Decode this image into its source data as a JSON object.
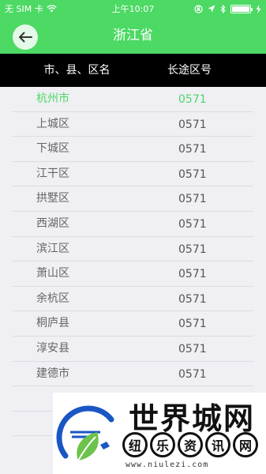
{
  "status_bar": {
    "carrier": "无 SIM 卡",
    "time": "上午10:07"
  },
  "nav": {
    "title": "浙江省"
  },
  "table": {
    "headers": [
      "市、县、区名",
      "长途区号"
    ],
    "rows": [
      {
        "name": "杭州市",
        "code": "0571"
      },
      {
        "name": "上城区",
        "code": "0571"
      },
      {
        "name": "下城区",
        "code": "0571"
      },
      {
        "name": "江干区",
        "code": "0571"
      },
      {
        "name": "拱墅区",
        "code": "0571"
      },
      {
        "name": "西湖区",
        "code": "0571"
      },
      {
        "name": "滨江区",
        "code": "0571"
      },
      {
        "name": "萧山区",
        "code": "0571"
      },
      {
        "name": "余杭区",
        "code": "0571"
      },
      {
        "name": "桐庐县",
        "code": "0571"
      },
      {
        "name": "淳安县",
        "code": "0571"
      },
      {
        "name": "建德市",
        "code": "0571"
      }
    ]
  },
  "watermark": {
    "title": "世界城网",
    "chars": [
      "纽",
      "乐",
      "资",
      "讯",
      "网"
    ],
    "url": "www.niulezi.com"
  },
  "colors": {
    "accent": "#4cd964",
    "header_bg": "#000000"
  }
}
